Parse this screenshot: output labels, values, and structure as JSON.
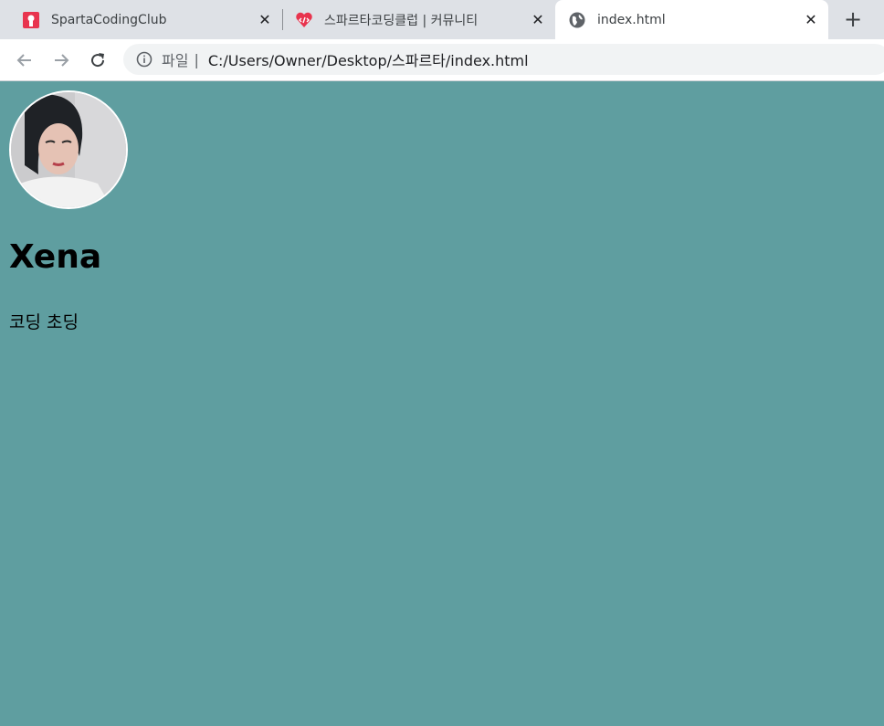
{
  "browser": {
    "tabs": [
      {
        "title": "SpartaCodingClub",
        "icon": "sparta-logo-icon"
      },
      {
        "title": "스파르타코딩클럽 | 커뮤니티",
        "icon": "heart-code-icon"
      },
      {
        "title": "index.html",
        "icon": "globe-icon",
        "active": true
      }
    ],
    "new_tab_glyph": "+",
    "close_glyph": "✕",
    "address": {
      "scheme": "파일",
      "separator": "|",
      "url": "C:/Users/Owner/Desktop/스파르타/index.html"
    }
  },
  "page": {
    "background": "#5f9ea0",
    "name": "Xena",
    "bio": "코딩 초딩"
  }
}
